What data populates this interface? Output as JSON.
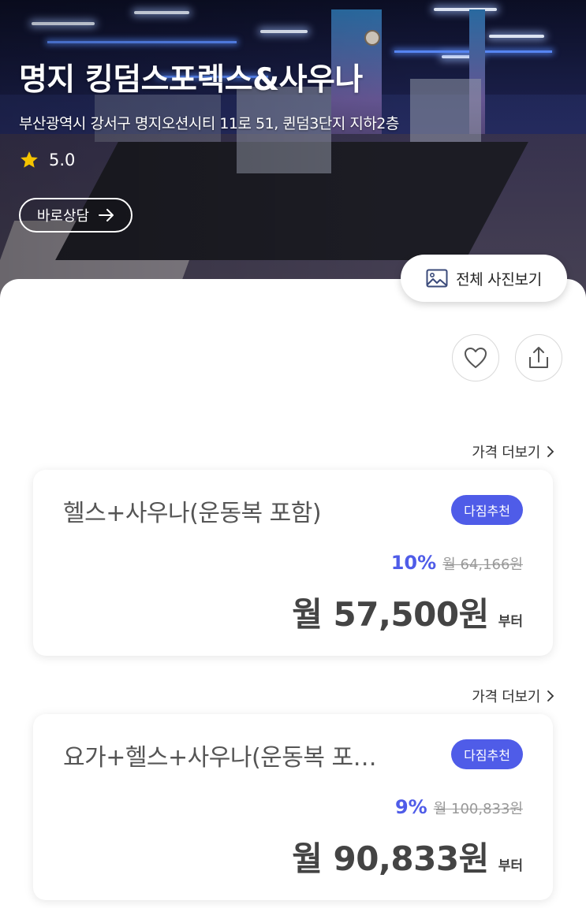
{
  "hero": {
    "title": "명지 킹덤스포렉스&사우나",
    "address": "부산광역시 강서구 명지오션시티 11로 51, 퀸덤3단지 지하2층",
    "rating": "5.0",
    "consult_label": "바로상담",
    "star_color": "#f5c400"
  },
  "actions": {
    "photos_label": "전체 사진보기"
  },
  "prices": [
    {
      "more_label": "가격 더보기",
      "name": "헬스+사우나(운동복 포함)",
      "badge": "다짐추천",
      "discount": "10%",
      "original": "월 64,166원",
      "final": "월 57,500원",
      "suffix": "부터"
    },
    {
      "more_label": "가격 더보기",
      "name": "요가+헬스+사우나(운동복 포…",
      "badge": "다짐추천",
      "discount": "9%",
      "original": "월 100,833원",
      "final": "월 90,833원",
      "suffix": "부터"
    }
  ],
  "colors": {
    "accent": "#4f5ce8"
  }
}
